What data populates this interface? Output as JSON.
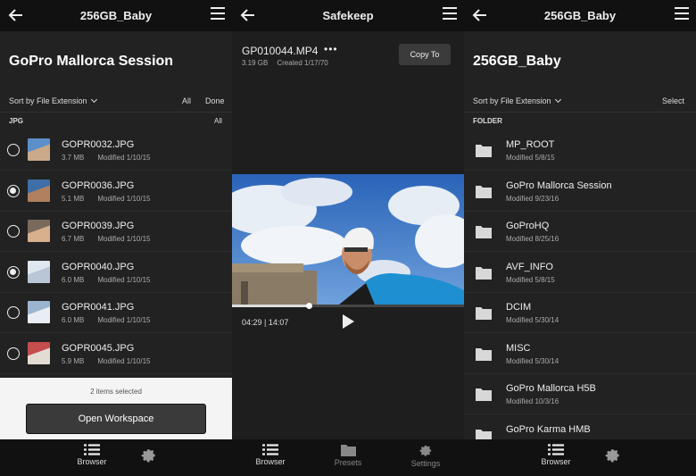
{
  "panel_left": {
    "topbar_title": "256GB_Baby",
    "page_title": "GoPro Mallorca Session",
    "sort_label": "Sort by File Extension",
    "all_label": "All",
    "done_label": "Done",
    "section_label": "JPG",
    "section_all_label": "All",
    "files": [
      {
        "name": "GOPR0032.JPG",
        "size": "3.7 MB",
        "modified": "Modified 1/10/15",
        "selected": false
      },
      {
        "name": "GOPR0036.JPG",
        "size": "5.1 MB",
        "modified": "Modified 1/10/15",
        "selected": true
      },
      {
        "name": "GOPR0039.JPG",
        "size": "6.7 MB",
        "modified": "Modified 1/10/15",
        "selected": false
      },
      {
        "name": "GOPR0040.JPG",
        "size": "6.0 MB",
        "modified": "Modified 1/10/15",
        "selected": true
      },
      {
        "name": "GOPR0041.JPG",
        "size": "6.0 MB",
        "modified": "Modified 1/10/15",
        "selected": false
      },
      {
        "name": "GOPR0045.JPG",
        "size": "5.9 MB",
        "modified": "Modified 1/10/15",
        "selected": false
      }
    ],
    "selection_count": "2 items selected",
    "open_button": "Open Workspace",
    "tab_browser": "Browser"
  },
  "panel_middle": {
    "topbar_title": "Safekeep",
    "file_name": "GP010044.MP4",
    "more_glyph": "•••",
    "file_size": "3.19 GB",
    "file_created": "Created 1/17/70",
    "copy_button": "Copy To",
    "playback_fraction": 0.33,
    "time_current": "04:29",
    "time_separator": "|",
    "time_total": "14:07",
    "tab_browser": "Browser",
    "tab_presets": "Presets",
    "tab_settings": "Settings"
  },
  "panel_right": {
    "topbar_title": "256GB_Baby",
    "page_title": "256GB_Baby",
    "sort_label": "Sort by File Extension",
    "select_label": "Select",
    "section_label": "FOLDER",
    "folders": [
      {
        "name": "MP_ROOT",
        "modified": "Modified 5/8/15"
      },
      {
        "name": "GoPro Mallorca Session",
        "modified": "Modified 9/23/16"
      },
      {
        "name": "GoProHQ",
        "modified": "Modified 8/25/16"
      },
      {
        "name": "AVF_INFO",
        "modified": "Modified 5/8/15"
      },
      {
        "name": "DCIM",
        "modified": "Modified 5/30/14"
      },
      {
        "name": "MISC",
        "modified": "Modified 5/30/14"
      },
      {
        "name": "GoPro Mallorca H5B",
        "modified": "Modified 10/3/16"
      },
      {
        "name": "GoPro Karma HMB",
        "modified": ""
      }
    ],
    "tab_browser": "Browser"
  },
  "colors": {
    "panel_bg": "#222222",
    "bar_bg": "#111111",
    "button_bg": "#3b3b3b",
    "sheet_bg": "#f4f4f4"
  },
  "icons": {
    "back": "back-arrow-icon",
    "menu": "hamburger-menu-icon",
    "browser": "list-icon",
    "settings": "gear-icon",
    "folder": "folder-icon",
    "play": "play-icon"
  }
}
